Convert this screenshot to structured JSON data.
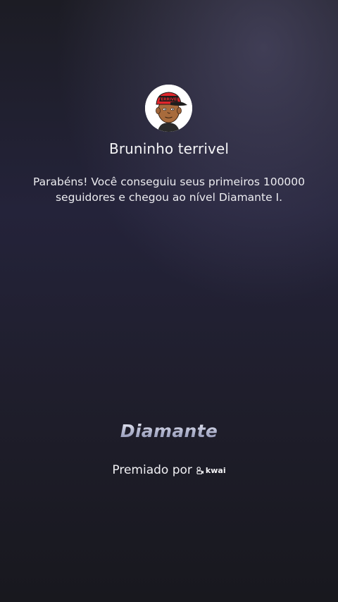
{
  "profile": {
    "username": "Bruninho terrivel",
    "avatar_icon": "cartoon-avatar-red-cap",
    "cap_text": "TERRIVEL"
  },
  "message": {
    "line1": "Parabéns! Você conseguiu seus primeiros 100000",
    "line2": "seguidores e chegou ao nível Diamante I."
  },
  "level": {
    "title": "Diamante"
  },
  "award": {
    "label": "Premiado por",
    "brand_icon": "kwai-logo-icon",
    "brand_name": "kwai"
  },
  "colors": {
    "background_top": "#1c1c24",
    "background_mid": "#24233a",
    "background_bottom": "#18181e",
    "cap_red": "#e0262c"
  }
}
